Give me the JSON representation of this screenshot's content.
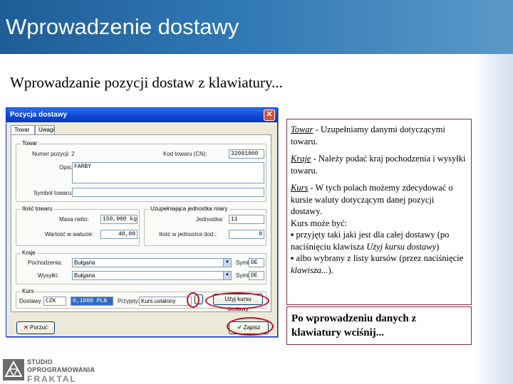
{
  "slide": {
    "title": "Wprowadzenie dostawy",
    "subtitle": "Wprowadzanie pozycji dostaw z klawiatury..."
  },
  "dialog": {
    "title": "Pozycja dostawy",
    "tabs": [
      "Towar",
      "Uwagi"
    ],
    "groups": {
      "towar": "Towar",
      "ilosc": "Ilość towaru",
      "jednostka": "Uzupełniająca jednostka miary",
      "kraje": "Kraje",
      "kurs": "Kurs"
    },
    "fields": {
      "numer_label": "Numer pozycji: 2",
      "kod_label": "Kod towaru (CN):",
      "kod_value": "32091000",
      "opis_label": "Opis:",
      "opis_value": "FARBY",
      "symbol_label": "Symbol towaru:",
      "symbol_value": "",
      "masa_label": "Masa netto:",
      "masa_value": "150,000 kg",
      "wartosc_label": "Wartość w walucie:",
      "wartosc_value": "40,00",
      "jednostka_label": "Jednostka:",
      "jednostka_value": "11",
      "ilosc_jm_label": "Ilość w jednostce dod.:",
      "ilosc_jm_value": "0",
      "pochodzenia_label": "Pochodzenia:",
      "pochodzenia_value": "Bułgaria",
      "pochodzenia_sym_label": "Symbol:",
      "pochodzenia_sym_value": "DE",
      "wysylki_label": "Wysyłki:",
      "wysylki_value": "Bułgaria",
      "wysylki_sym_label": "Symbol:",
      "wysylki_sym_value": "DE",
      "waluta_label": "Dostawy",
      "waluta_value": "CZK",
      "kurs_value": "0,1000 PLN",
      "przyjety_label": "Przyjęty:",
      "przyjety_value": "Kurs ustalony"
    },
    "buttons": {
      "uzyj_kursu": "Użyj kursu dostawy",
      "porzuc": "Porzuć",
      "zapisz": "Zapisz"
    }
  },
  "info": {
    "towar_term": "Towar",
    "towar_text": " - Uzupełniamy danymi dotyczącymi towaru.",
    "kraje_term": "Kraje",
    "kraje_text": " - Należy podać kraj pochodzenia i wysyłki towaru.",
    "kurs_term": "Kurs",
    "kurs_text": " - W tych polach możemy zdecydować o kursie waluty dotyczącym danej pozycji dostawy.",
    "kurs_moze": "Kurs może być:",
    "opt1_a": "▪ przyjęty taki jaki jest dla całej dostawy (po naciśnięciu klawisza ",
    "opt1_key": "Użyj kursu dostawy",
    "opt1_b": ")",
    "opt2_a": "▪ albo wybrany z listy kursów (przez naciśnięcie ",
    "opt2_key": "klawisza...",
    "opt2_b": ")."
  },
  "cta": "Po wprowadzeniu danych z klawiatury wciśnij...",
  "logo": {
    "line1": "STUDIO",
    "line2": "OPROGRAMOWANIA",
    "line3": "FRAKTAL"
  },
  "colors": {
    "banner": "#2f78b4",
    "box_border": "#8a2846",
    "highlight_ring": "#c0102a"
  }
}
